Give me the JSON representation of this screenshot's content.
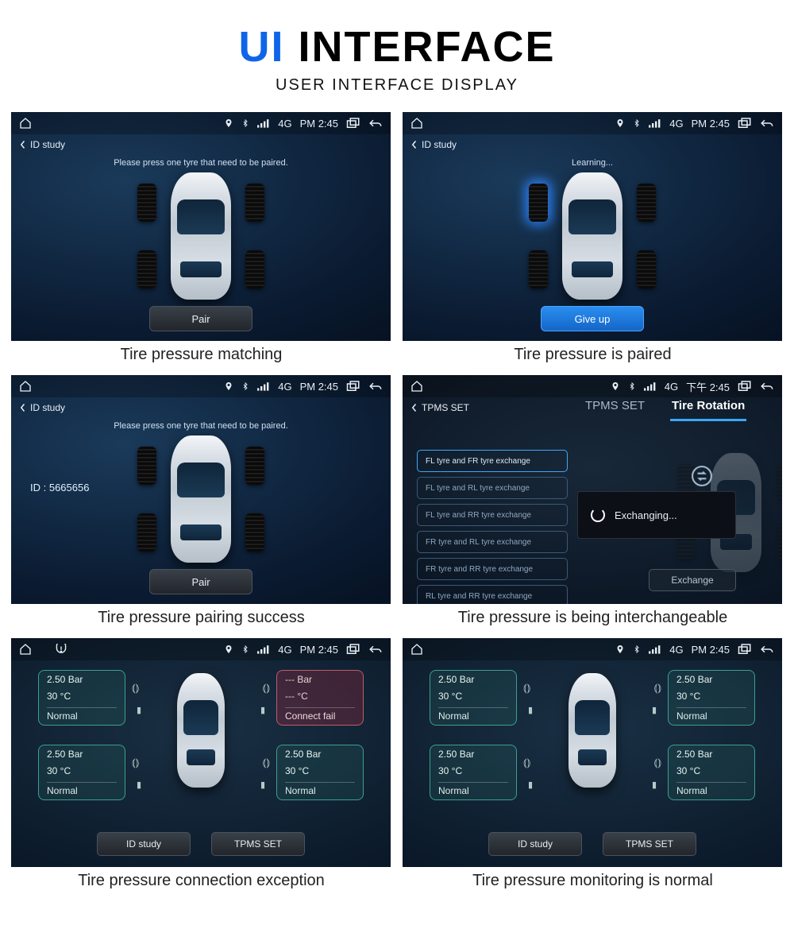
{
  "header": {
    "title_blue": "UI",
    "title_rest": " INTERFACE",
    "subtitle": "USER INTERFACE DISPLAY"
  },
  "status": {
    "network": "4G",
    "time": "PM 2:45",
    "time_alt": "下午 2:45"
  },
  "captions": {
    "s1": "Tire pressure matching",
    "s2": "Tire pressure is paired",
    "s3": "Tire pressure pairing success",
    "s4": "Tire pressure is being interchangeable",
    "s5": "Tire pressure connection exception",
    "s6": "Tire pressure monitoring is normal"
  },
  "screens": {
    "s1": {
      "back": "ID study",
      "instruction": "Please press one tyre that need to be paired.",
      "button": "Pair"
    },
    "s2": {
      "back": "ID study",
      "instruction": "Learning...",
      "button": "Give up"
    },
    "s3": {
      "back": "ID study",
      "instruction": "Please press one tyre that need to be paired.",
      "id_label": "ID : 5665656",
      "button": "Pair"
    },
    "s4": {
      "back": "TPMS SET",
      "tabs": {
        "tab1": "TPMS SET",
        "tab2": "Tire Rotation"
      },
      "items": [
        "FL tyre and FR tyre exchange",
        "FL tyre and RL tyre exchange",
        "FL tyre and RR tyre exchange",
        "FR tyre and RL tyre exchange",
        "FR tyre and RR tyre exchange",
        "RL tyre and RR tyre exchange"
      ],
      "button": "Exchange",
      "modal": "Exchanging..."
    },
    "s5": {
      "fl": {
        "pressure": "2.50  Bar",
        "temp": "30  °C",
        "status": "Normal"
      },
      "fr": {
        "pressure": "---  Bar",
        "temp": "---  °C",
        "status": "Connect fail"
      },
      "rl": {
        "pressure": "2.50  Bar",
        "temp": "30  °C",
        "status": "Normal"
      },
      "rr": {
        "pressure": "2.50  Bar",
        "temp": "30  °C",
        "status": "Normal"
      },
      "btn1": "ID study",
      "btn2": "TPMS SET"
    },
    "s6": {
      "fl": {
        "pressure": "2.50  Bar",
        "temp": "30  °C",
        "status": "Normal"
      },
      "fr": {
        "pressure": "2.50  Bar",
        "temp": "30  °C",
        "status": "Normal"
      },
      "rl": {
        "pressure": "2.50  Bar",
        "temp": "30  °C",
        "status": "Normal"
      },
      "rr": {
        "pressure": "2.50  Bar",
        "temp": "30  °C",
        "status": "Normal"
      },
      "btn1": "ID study",
      "btn2": "TPMS SET"
    }
  }
}
